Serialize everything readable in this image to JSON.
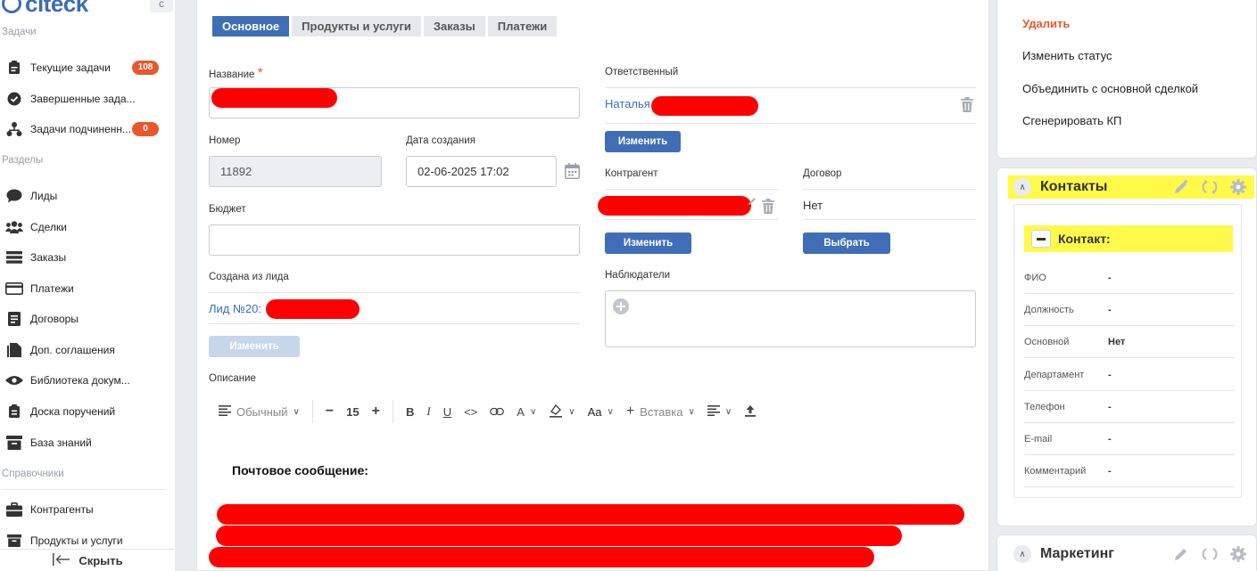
{
  "sidebar": {
    "logo_text": "citeck",
    "collapse_glyph": "c",
    "section_tasks": "Задачи",
    "tasks": [
      {
        "label": "Текущие задачи",
        "badge": "108"
      },
      {
        "label": "Завершенные зада..."
      },
      {
        "label": "Задачи подчиненн...",
        "badge": "0"
      }
    ],
    "section_sections": "Разделы",
    "sections": [
      {
        "label": "Лиды"
      },
      {
        "label": "Сделки"
      },
      {
        "label": "Заказы"
      },
      {
        "label": "Платежи"
      },
      {
        "label": "Договоры"
      },
      {
        "label": "Доп. соглашения"
      },
      {
        "label": "Библиотека докум..."
      },
      {
        "label": "Доска поручений"
      },
      {
        "label": "База знаний"
      }
    ],
    "section_refs": "Справочники",
    "refs": [
      {
        "label": "Контрагенты"
      },
      {
        "label": "Продукты и услуги"
      }
    ],
    "hide_label": "Скрыть"
  },
  "main": {
    "tabs": [
      {
        "label": "Основное",
        "active": true
      },
      {
        "label": "Продукты и услуги"
      },
      {
        "label": "Заказы"
      },
      {
        "label": "Платежи"
      }
    ],
    "name_label": "Название",
    "required_mark": "*",
    "number_label": "Номер",
    "number_value": "11892",
    "created_label": "Дата создания",
    "created_value": "02-06-2025 17:02",
    "budget_label": "Бюджет",
    "from_lead_label": "Создана из лида",
    "from_lead_link": "Лид №20:",
    "change_disabled": "Изменить",
    "description_label": "Описание",
    "responsible_label": "Ответственный",
    "responsible_link": "Наталья",
    "change_btn_1": "Изменить",
    "counterparty_label": "Контрагент",
    "change_btn_2": "Изменить",
    "contract_label": "Договор",
    "contract_value": "Нет",
    "select_btn": "Выбрать",
    "observers_label": "Наблюдатели",
    "editor": {
      "style": "Обычный",
      "font_size": "15",
      "font_glyph": "A",
      "case_glyph": "Aa",
      "insert": "Вставка"
    },
    "mail_heading": "Почтовое сообщение:"
  },
  "actions": [
    {
      "label": "Удалить",
      "danger": true
    },
    {
      "label": "Изменить статус"
    },
    {
      "label": "Объединить с основной сделкой"
    },
    {
      "label": "Сгенерировать КП"
    }
  ],
  "contacts": {
    "title": "Контакты",
    "contact_title": "Контакт:",
    "fields": [
      {
        "key": "ФИО",
        "value": "-"
      },
      {
        "key": "Должность",
        "value": "-"
      },
      {
        "key": "Основной",
        "value": "Нет"
      },
      {
        "key": "Департамент",
        "value": "-"
      },
      {
        "key": "Телефон",
        "value": "-"
      },
      {
        "key": "E-mail",
        "value": "-"
      },
      {
        "key": "Комментарий",
        "value": "-"
      }
    ]
  },
  "marketing": {
    "title": "Маркетинг"
  },
  "colors": {
    "accent": "#3f6eb7",
    "badge": "#e8582c",
    "highlight": "#fff94a",
    "redaction": "#ff0000"
  }
}
